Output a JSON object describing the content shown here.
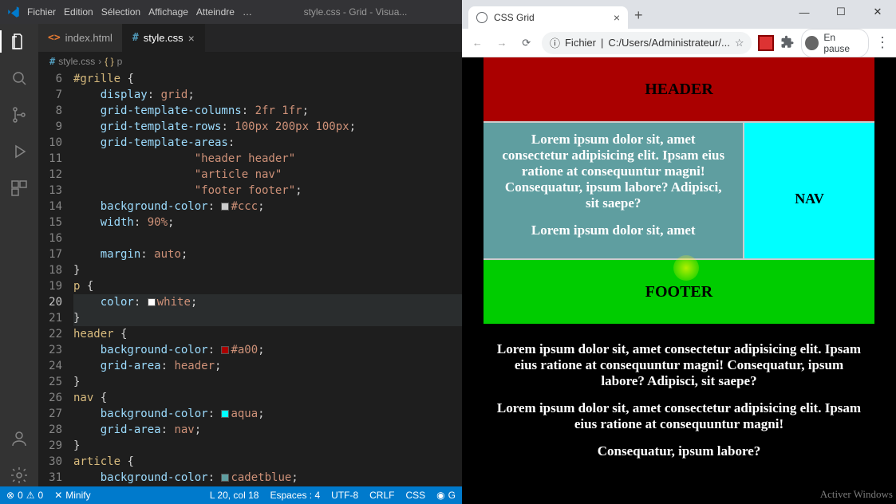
{
  "vscode": {
    "menus": [
      "Fichier",
      "Edition",
      "Sélection",
      "Affichage",
      "Atteindre",
      "…"
    ],
    "window_title": "style.css - Grid - Visua...",
    "tabs": [
      {
        "label": "index.html",
        "active": false
      },
      {
        "label": "style.css",
        "active": true
      }
    ],
    "breadcrumbs": [
      {
        "icon": "#",
        "label": "style.css"
      },
      {
        "icon": "{ }",
        "label": "p"
      }
    ],
    "gutter_start": 6,
    "gutter_cursor": 20,
    "code_lines": {
      "6": {
        "sel": "#grille",
        "after": " {"
      },
      "7": {
        "prop": "display",
        "val": "grid"
      },
      "8": {
        "prop": "grid-template-columns",
        "val": "2fr 1fr"
      },
      "9": {
        "prop": "grid-template-rows",
        "val": "100px 200px 100px"
      },
      "10": {
        "prop": "grid-template-areas",
        "noSemi": true
      },
      "11": {
        "str": "\"header header\""
      },
      "12": {
        "str": "\"article nav\""
      },
      "13": {
        "str": "\"footer footer\"",
        "semi": true
      },
      "14": {
        "prop": "background-color",
        "swatch": "#ccc",
        "val": "#ccc"
      },
      "15": {
        "prop": "width",
        "val": "90%"
      },
      "16": {
        "blank": true
      },
      "17": {
        "prop": "margin",
        "val": "auto"
      },
      "18": {
        "close": true
      },
      "19": {
        "sel": "p",
        "after": " {"
      },
      "20": {
        "prop": "color",
        "swatch": "white",
        "val": "white",
        "hl": true
      },
      "21": {
        "close": true,
        "hl": true
      },
      "22": {
        "sel": "header",
        "after": " {"
      },
      "23": {
        "prop": "background-color",
        "swatch": "#a00",
        "val": "#a00"
      },
      "24": {
        "prop": "grid-area",
        "val": "header"
      },
      "25": {
        "close": true
      },
      "26": {
        "sel": "nav",
        "after": " {"
      },
      "27": {
        "prop": "background-color",
        "swatch": "aqua",
        "val": "aqua"
      },
      "28": {
        "prop": "grid-area",
        "val": "nav"
      },
      "29": {
        "close": true
      },
      "30": {
        "sel": "article",
        "after": " {"
      },
      "31": {
        "prop": "background-color",
        "swatch": "cadetblue",
        "val": "cadetblue"
      }
    },
    "status": {
      "errors": "0",
      "warnings": "0",
      "minify": "Minify",
      "position": "L 20, col 18",
      "spaces": "Espaces : 4",
      "encoding": "UTF-8",
      "eol": "CRLF",
      "lang": "CSS",
      "live": "G"
    }
  },
  "chrome": {
    "tab_title": "CSS Grid",
    "address_label": "Fichier",
    "address_path": "C:/Users/Administrateur/...",
    "pause_label": "En pause"
  },
  "page": {
    "header": "HEADER",
    "nav": "NAV",
    "footer": "FOOTER",
    "article_p1": "Lorem ipsum dolor sit, amet consectetur adipisicing elit. Ipsam eius ratione at consequuntur magni! Consequatur, ipsum labore? Adipisci, sit saepe?",
    "article_p2": "Lorem ipsum dolor sit, amet",
    "after_p1": "Lorem ipsum dolor sit, amet consectetur adipisicing elit. Ipsam eius ratione at consequuntur magni! Consequatur, ipsum labore? Adipisci, sit saepe?",
    "after_p2": "Lorem ipsum dolor sit, amet consectetur adipisicing elit. Ipsam eius ratione at consequuntur magni!",
    "after_p3": "Consequatur, ipsum labore?"
  },
  "watermark": "Activer Windows"
}
